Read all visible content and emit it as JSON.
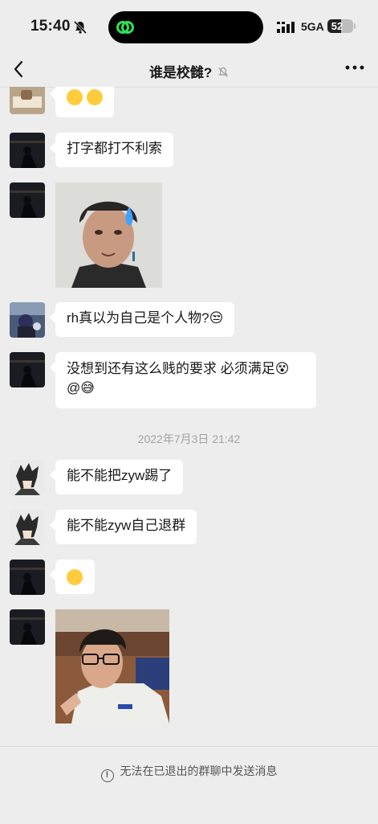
{
  "status_bar": {
    "time": "15:40",
    "network": "5GA",
    "battery": "52",
    "battery_level": 0.52
  },
  "nav": {
    "title": "谁是校雠?"
  },
  "messages": [
    {
      "type": "emoji",
      "avatar": "avatar-reading",
      "text": "🤔🤔"
    },
    {
      "type": "text",
      "avatar": "avatar-dark-photo",
      "text": "打字都打不利索"
    },
    {
      "type": "sticker",
      "avatar": "avatar-dark-photo",
      "description": "meme-face-sticker"
    },
    {
      "type": "text",
      "avatar": "avatar-anime-character",
      "text": "rh真以为自己是个人物?😒"
    },
    {
      "type": "text",
      "avatar": "avatar-dark-photo",
      "text": "没想到还有这么贱的要求 必须满足😵",
      "text_line2": "@😅"
    },
    {
      "type": "text",
      "avatar": "avatar-anime-sketch",
      "text": "能不能把zyw踢了"
    },
    {
      "type": "text",
      "avatar": "avatar-anime-sketch",
      "text": "能不能zyw自己退群"
    },
    {
      "type": "emoji",
      "avatar": "avatar-dark-photo",
      "text": "🙄"
    },
    {
      "type": "sticker",
      "avatar": "avatar-dark-photo",
      "description": "selfie-photo-sticker"
    }
  ],
  "timestamp": "2022年7月3日 21:42",
  "footer": {
    "note": "无法在已退出的群聊中发送消息"
  },
  "colors": {
    "background": "#ededed",
    "bubble": "#ffffff",
    "meta_text": "#a3a3a3"
  }
}
